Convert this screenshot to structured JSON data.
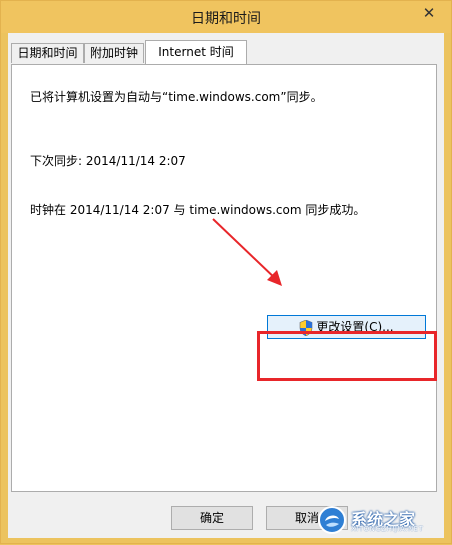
{
  "window": {
    "title": "日期和时间"
  },
  "tabs": [
    {
      "label": "日期和时间",
      "active": false
    },
    {
      "label": "附加时钟",
      "active": false
    },
    {
      "label": "Internet 时间",
      "active": true
    }
  ],
  "panel": {
    "sync_status": "已将计算机设置为自动与“time.windows.com”同步。",
    "next_sync": "下次同步: 2014/11/14 2:07",
    "last_sync": "时钟在 2014/11/14 2:07 与 time.windows.com 同步成功。",
    "change_settings_label": "更改设置(C)..."
  },
  "footer": {
    "ok_label": "确定",
    "cancel_label": "取消"
  },
  "watermark": {
    "title": "系统之家",
    "subtitle": "XITONGZHIJIA.NET"
  },
  "colors": {
    "frame": "#ecc35e",
    "annotation": "#e8262a"
  }
}
